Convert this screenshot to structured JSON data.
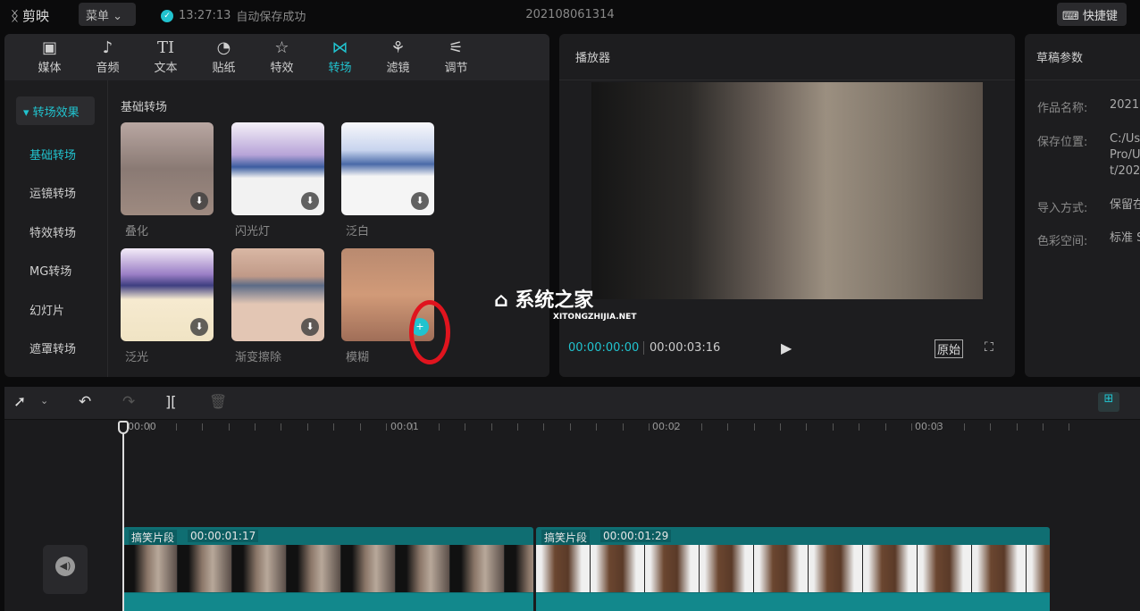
{
  "app": {
    "name": "剪映",
    "menu": "菜单",
    "save_time": "13:27:13",
    "save_status": "自动保存成功",
    "project_title": "202108061314",
    "shortcut": "快捷键"
  },
  "tabs": [
    {
      "icon": "media-icon",
      "label": "媒体"
    },
    {
      "icon": "audio-icon",
      "label": "音频"
    },
    {
      "icon": "text-icon",
      "label": "文本"
    },
    {
      "icon": "sticker-icon",
      "label": "贴纸"
    },
    {
      "icon": "effects-icon",
      "label": "特效"
    },
    {
      "icon": "transition-icon",
      "label": "转场"
    },
    {
      "icon": "filter-icon",
      "label": "滤镜"
    },
    {
      "icon": "adjust-icon",
      "label": "调节"
    }
  ],
  "sidebar": {
    "header": "转场效果",
    "items": [
      "基础转场",
      "运镜转场",
      "特效转场",
      "MG转场",
      "幻灯片",
      "遮罩转场"
    ]
  },
  "section_title": "基础转场",
  "cards": [
    "叠化",
    "闪光灯",
    "泛白",
    "泛光",
    "渐变擦除",
    "模糊"
  ],
  "player": {
    "title": "播放器",
    "current": "00:00:00:00",
    "total": "00:00:03:16",
    "ratio": "原始"
  },
  "draft": {
    "title": "草稿参数",
    "rows": [
      {
        "label": "作品名称:",
        "value": "2021"
      },
      {
        "label": "保存位置:",
        "value": "C:/Us\nPro/U\nt/202"
      },
      {
        "label": "导入方式:",
        "value": "保留在"
      },
      {
        "label": "色彩空间:",
        "value": "标准 S"
      }
    ]
  },
  "ruler": [
    "00:00",
    "00:01",
    "00:02",
    "00:03"
  ],
  "clips": [
    {
      "name": "搞笑片段",
      "duration": "00:00:01:17"
    },
    {
      "name": "搞笑片段",
      "duration": "00:00:01:29"
    }
  ],
  "watermark": {
    "cn": "系统之家",
    "en": "XITONGZHIJIA.NET"
  },
  "colors": {
    "accent": "#21c3cf",
    "clip": "#0f6e72",
    "annotation": "#e0141e"
  }
}
